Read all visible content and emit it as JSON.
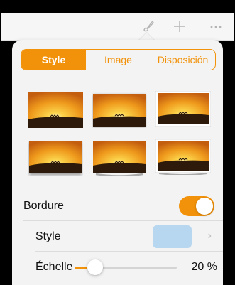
{
  "toolbar": {
    "icons": [
      "paintbrush-icon",
      "plus-icon",
      "more-icon"
    ]
  },
  "tabs": [
    {
      "label": "Style",
      "active": true
    },
    {
      "label": "Image",
      "active": false
    },
    {
      "label": "Disposición",
      "active": false
    }
  ],
  "thumbnails": [
    {
      "style": "plain"
    },
    {
      "style": "soft-shadow"
    },
    {
      "style": "white-frame"
    },
    {
      "style": "drop-shadow"
    },
    {
      "style": "curved-shadow"
    },
    {
      "style": "curled-frame"
    }
  ],
  "border": {
    "label": "Bordure",
    "enabled": true
  },
  "style_row": {
    "label": "Style",
    "swatch_color": "#b7d6f0"
  },
  "scale_row": {
    "label": "Échelle",
    "percent": 20,
    "value_text": "20 %"
  },
  "colors": {
    "accent": "#f2920a"
  }
}
